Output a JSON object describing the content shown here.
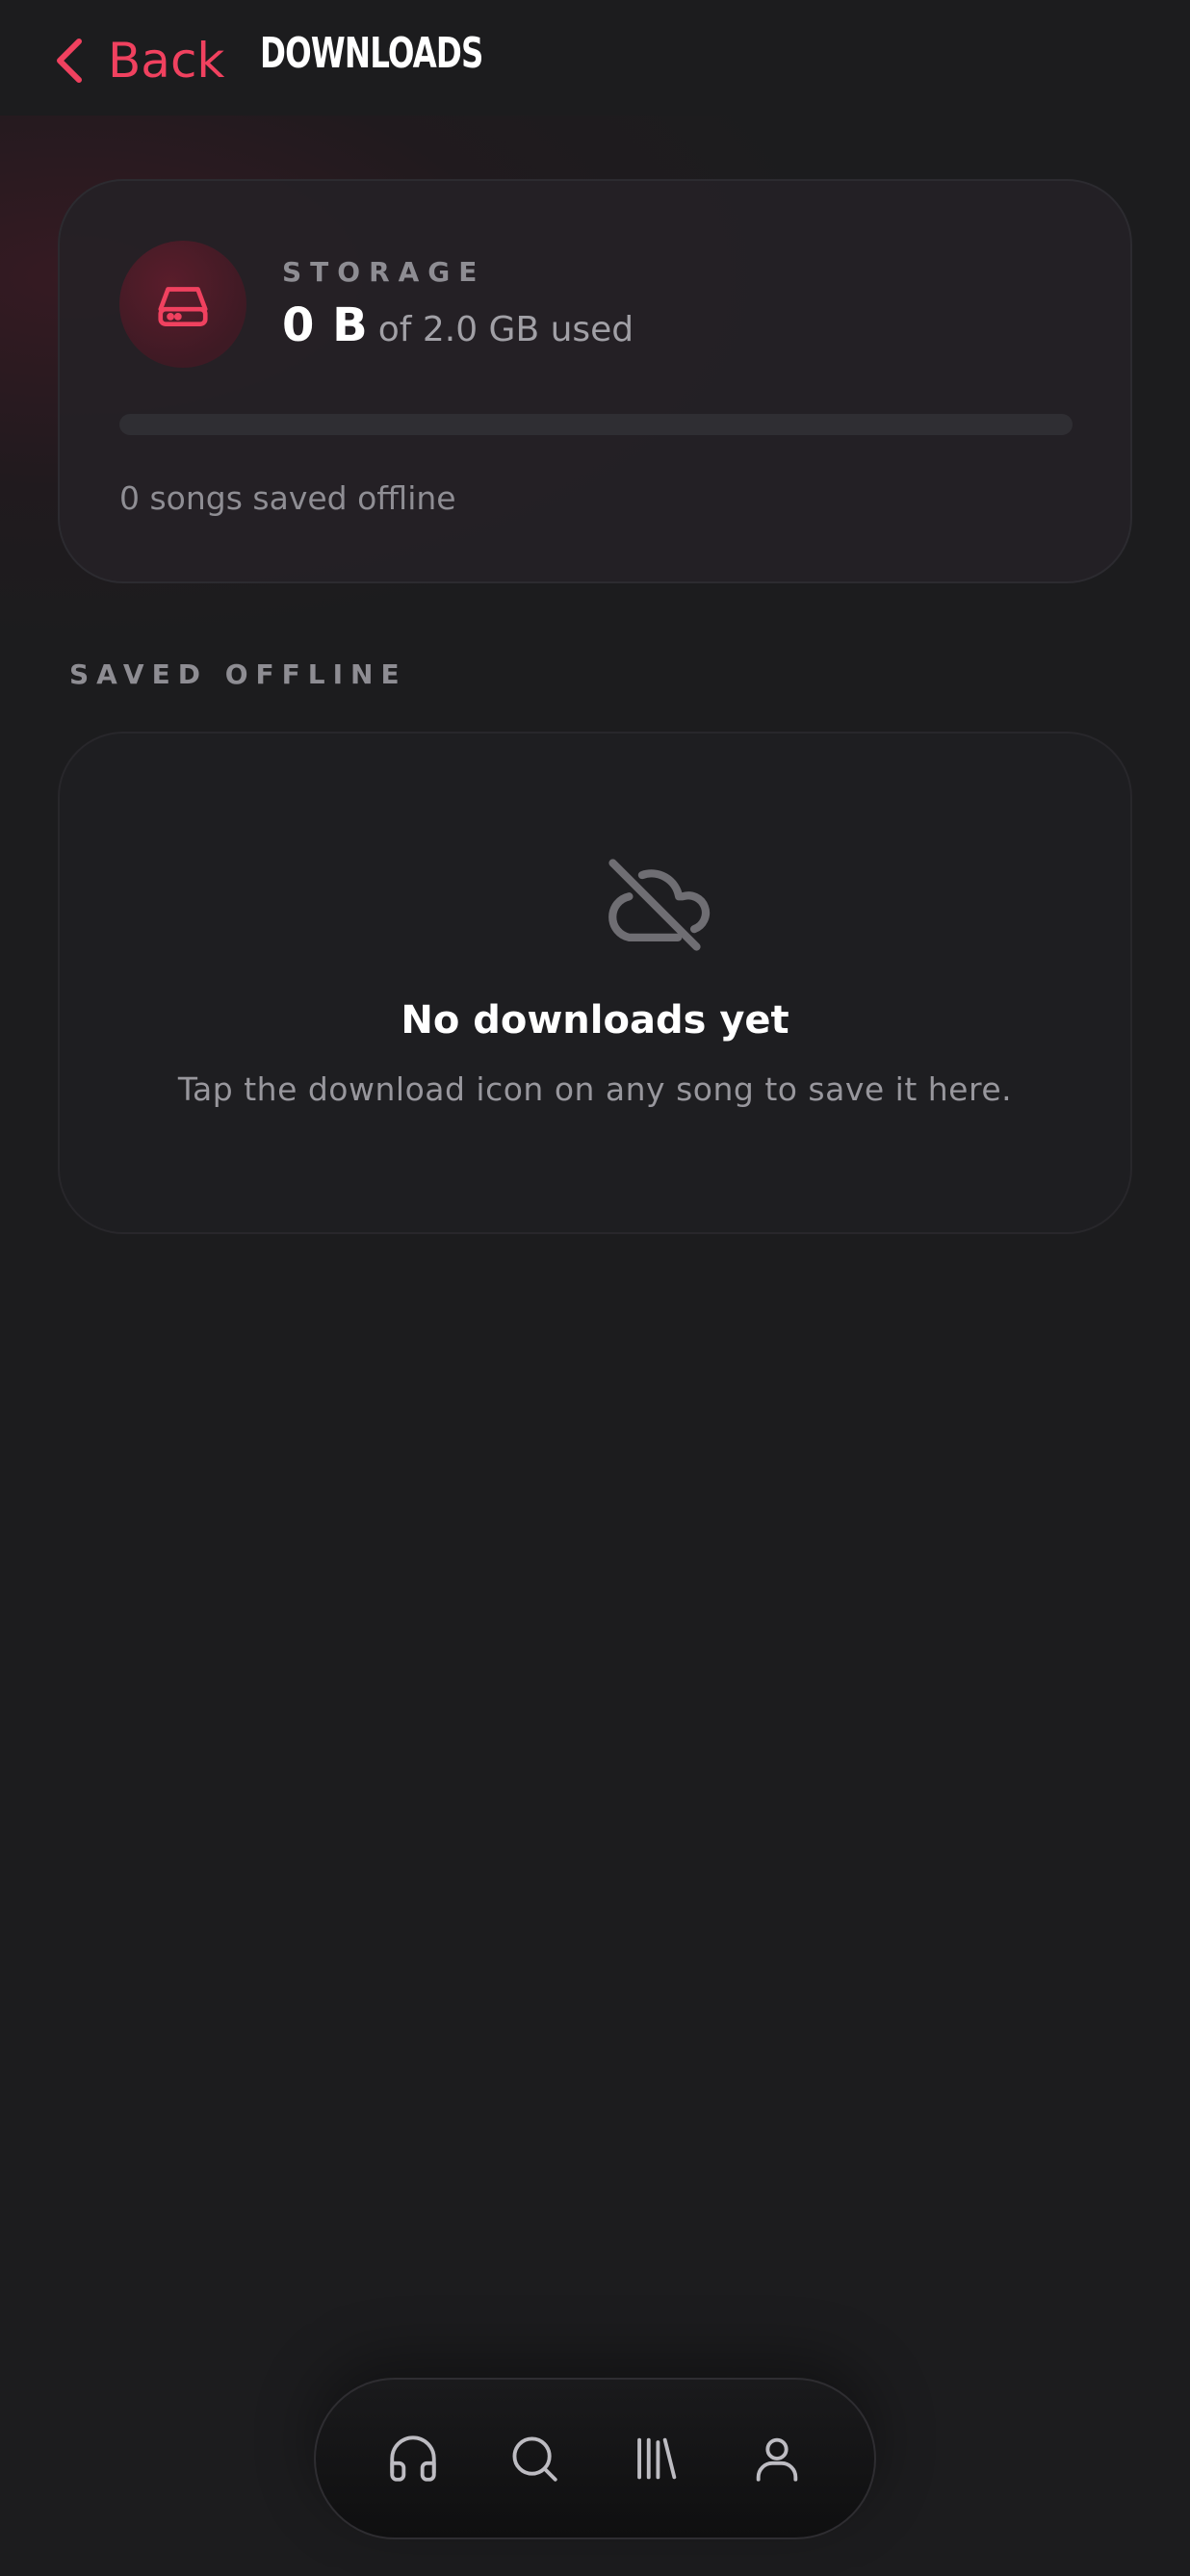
{
  "header": {
    "back_label": "Back",
    "title": "DOWNLOADS"
  },
  "storage": {
    "label": "STORAGE",
    "used": "0 B",
    "total_text": "of 2.0 GB used",
    "progress_fraction": 0,
    "songs_text": "0 songs saved offline",
    "icon": "hard-drive-icon"
  },
  "saved": {
    "section_label": "SAVED OFFLINE",
    "empty_icon": "cloud-off-icon",
    "empty_title": "No downloads yet",
    "empty_desc": "Tap the download icon on any song to save it here."
  },
  "tabbar": {
    "items": [
      {
        "icon": "headphones-icon"
      },
      {
        "icon": "search-icon"
      },
      {
        "icon": "library-icon"
      },
      {
        "icon": "profile-icon"
      }
    ]
  },
  "colors": {
    "accent": "#f0415f",
    "background": "#1c1c1e",
    "muted_text": "#8e8d93"
  }
}
